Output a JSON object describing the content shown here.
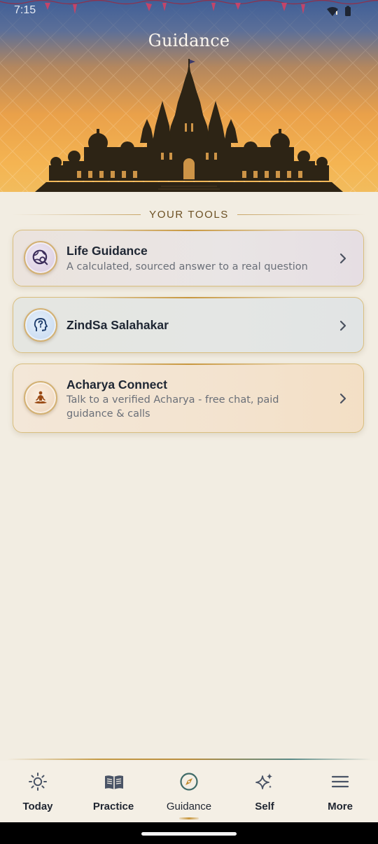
{
  "status_bar": {
    "time": "7:15"
  },
  "header": {
    "title": "Guidance"
  },
  "section": {
    "label": "YOUR TOOLS"
  },
  "cards": [
    {
      "title": "Life Guidance",
      "subtitle": "A calculated, sourced answer to a real question",
      "icon": "globe-search-icon"
    },
    {
      "title": "ZindSa Salahakar",
      "subtitle": "",
      "icon": "head-question-icon"
    },
    {
      "title": "Acharya Connect",
      "subtitle": "Talk to a verified Acharya - free chat, paid guidance & calls",
      "icon": "meditating-person-icon"
    }
  ],
  "bottom_nav": {
    "active": "Guidance",
    "items": [
      {
        "label": "Today",
        "icon": "sun-icon"
      },
      {
        "label": "Practice",
        "icon": "book-icon"
      },
      {
        "label": "Guidance",
        "icon": "compass-icon"
      },
      {
        "label": "Self",
        "icon": "sparkles-icon"
      },
      {
        "label": "More",
        "icon": "menu-icon"
      }
    ]
  },
  "colors": {
    "accent_gold": "#c8963c",
    "page_bg": "#f2ede2",
    "text_dark": "#1e2633",
    "compass_teal": "#3f6b68"
  }
}
